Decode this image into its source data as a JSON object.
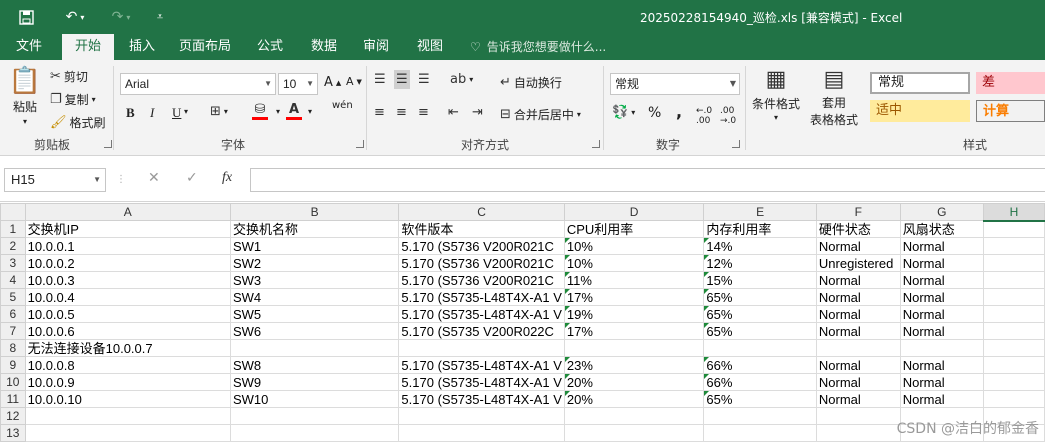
{
  "window": {
    "title": "20250228154940_巡检.xls  [兼容模式] - Excel"
  },
  "ribbon_tabs": [
    "文件",
    "开始",
    "插入",
    "页面布局",
    "公式",
    "数据",
    "审阅",
    "视图"
  ],
  "tell_me": "告诉我您想要做什么...",
  "clipboard": {
    "paste": "粘贴",
    "cut": "剪切",
    "copy": "复制",
    "format_painter": "格式刷",
    "label": "剪贴板"
  },
  "font": {
    "name": "Arial",
    "size": "10",
    "label": "字体",
    "bold": "B",
    "italic": "I",
    "underline": "U",
    "wen": "wén"
  },
  "alignment": {
    "wrap": "自动换行",
    "merge": "合并后居中",
    "label": "对齐方式"
  },
  "number": {
    "format": "常规",
    "label": "数字",
    "percent": "%",
    "comma": ","
  },
  "styles": {
    "conditional": "条件格式",
    "table_format_1": "套用",
    "table_format_2": "表格格式",
    "label": "样式",
    "normal": "常规",
    "bad": "差",
    "neutral": "适中",
    "calc": "计算",
    "colors": {
      "bad_bg": "#ffc7ce",
      "bad_fg": "#9c0006",
      "neutral_bg": "#ffeb9c",
      "neutral_fg": "#9c5700",
      "calc_bg": "#f2f2f2",
      "calc_fg": "#fa7d00"
    }
  },
  "formula_bar": {
    "name_box": "H15",
    "fx": "fx",
    "cancel": "✕",
    "enter": "✓"
  },
  "sheet": {
    "columns": [
      "A",
      "B",
      "C",
      "D",
      "E",
      "F",
      "G",
      "H"
    ],
    "rows": [
      {
        "n": "1",
        "cells": [
          "交换机IP",
          "交换机名称",
          "软件版本",
          "CPU利用率",
          "内存利用率",
          "硬件状态",
          "风扇状态",
          ""
        ]
      },
      {
        "n": "2",
        "cells": [
          "10.0.0.1",
          "SW1",
          "5.170 (S5736 V200R021C",
          "10%",
          "14%",
          "Normal",
          "Normal",
          ""
        ]
      },
      {
        "n": "3",
        "cells": [
          "10.0.0.2",
          "SW2",
          "5.170 (S5736 V200R021C",
          "10%",
          "12%",
          "Unregistered",
          "Normal",
          ""
        ]
      },
      {
        "n": "4",
        "cells": [
          "10.0.0.3",
          "SW3",
          "5.170 (S5736 V200R021C",
          "11%",
          "15%",
          "Normal",
          "Normal",
          ""
        ]
      },
      {
        "n": "5",
        "cells": [
          "10.0.0.4",
          "SW4",
          "5.170 (S5735-L48T4X-A1 V",
          "17%",
          "65%",
          "Normal",
          "Normal",
          ""
        ]
      },
      {
        "n": "6",
        "cells": [
          "10.0.0.5",
          "SW5",
          "5.170 (S5735-L48T4X-A1 V",
          "19%",
          "65%",
          "Normal",
          "Normal",
          ""
        ]
      },
      {
        "n": "7",
        "cells": [
          "10.0.0.6",
          "SW6",
          "5.170 (S5735 V200R022C",
          "17%",
          "65%",
          "Normal",
          "Normal",
          ""
        ]
      },
      {
        "n": "8",
        "cells": [
          "无法连接设备10.0.0.7",
          "",
          "",
          "",
          "",
          "",
          "",
          ""
        ]
      },
      {
        "n": "9",
        "cells": [
          "10.0.0.8",
          "SW8",
          "5.170 (S5735-L48T4X-A1 V",
          "23%",
          "66%",
          "Normal",
          "Normal",
          ""
        ]
      },
      {
        "n": "10",
        "cells": [
          "10.0.0.9",
          "SW9",
          "5.170 (S5735-L48T4X-A1 V",
          "20%",
          "66%",
          "Normal",
          "Normal",
          ""
        ]
      },
      {
        "n": "11",
        "cells": [
          "10.0.0.10",
          "SW10",
          "5.170 (S5735-L48T4X-A1 V",
          "20%",
          "65%",
          "Normal",
          "Normal",
          ""
        ]
      },
      {
        "n": "12",
        "cells": [
          "",
          "",
          "",
          "",
          "",
          "",
          "",
          ""
        ]
      },
      {
        "n": "13",
        "cells": [
          "",
          "",
          "",
          "",
          "",
          "",
          "",
          ""
        ]
      }
    ]
  },
  "watermark": "CSDN @洁白的郁金香",
  "theme": {
    "accent": "#217346"
  }
}
